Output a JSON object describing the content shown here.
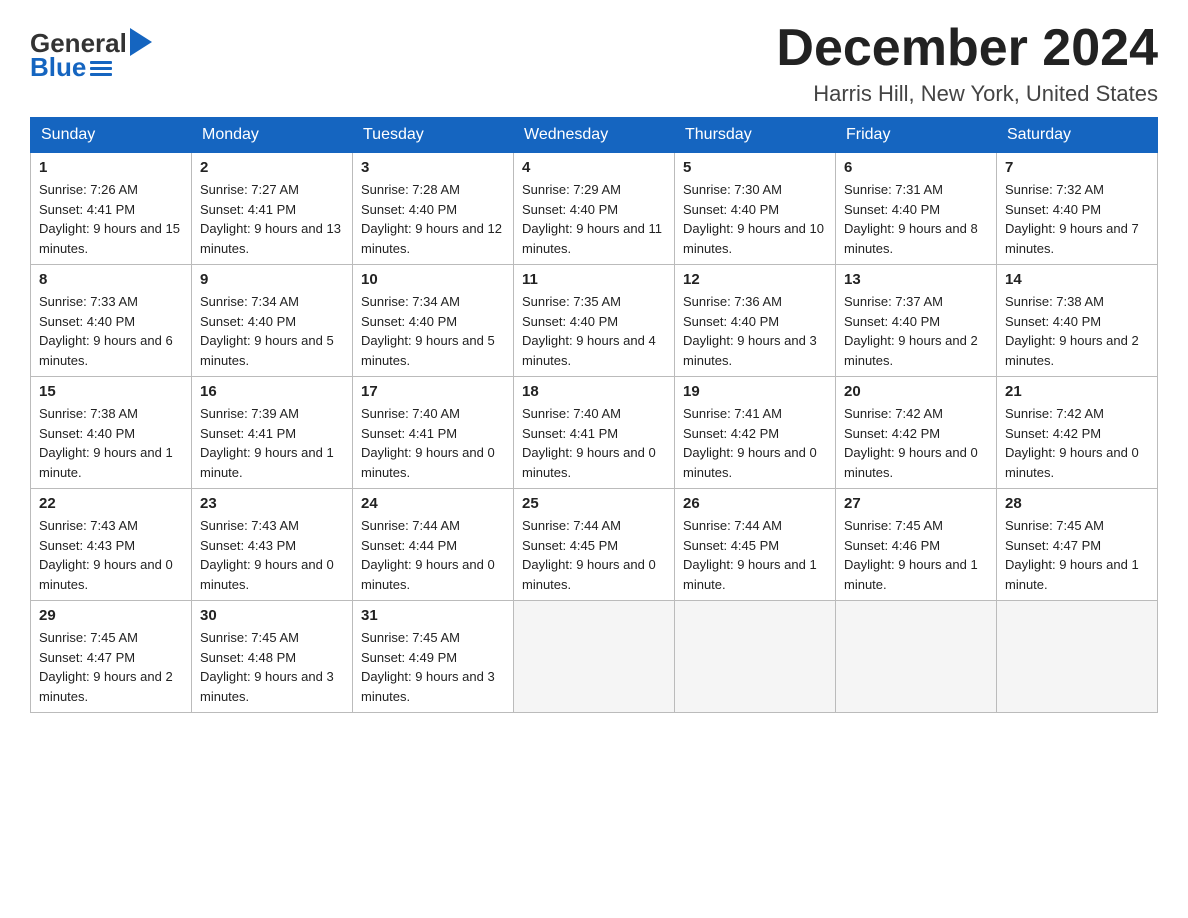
{
  "header": {
    "logo_general": "General",
    "logo_blue": "Blue",
    "month_title": "December 2024",
    "location": "Harris Hill, New York, United States"
  },
  "days_of_week": [
    "Sunday",
    "Monday",
    "Tuesday",
    "Wednesday",
    "Thursday",
    "Friday",
    "Saturday"
  ],
  "weeks": [
    [
      {
        "day": "1",
        "sunrise": "7:26 AM",
        "sunset": "4:41 PM",
        "daylight": "9 hours and 15 minutes."
      },
      {
        "day": "2",
        "sunrise": "7:27 AM",
        "sunset": "4:41 PM",
        "daylight": "9 hours and 13 minutes."
      },
      {
        "day": "3",
        "sunrise": "7:28 AM",
        "sunset": "4:40 PM",
        "daylight": "9 hours and 12 minutes."
      },
      {
        "day": "4",
        "sunrise": "7:29 AM",
        "sunset": "4:40 PM",
        "daylight": "9 hours and 11 minutes."
      },
      {
        "day": "5",
        "sunrise": "7:30 AM",
        "sunset": "4:40 PM",
        "daylight": "9 hours and 10 minutes."
      },
      {
        "day": "6",
        "sunrise": "7:31 AM",
        "sunset": "4:40 PM",
        "daylight": "9 hours and 8 minutes."
      },
      {
        "day": "7",
        "sunrise": "7:32 AM",
        "sunset": "4:40 PM",
        "daylight": "9 hours and 7 minutes."
      }
    ],
    [
      {
        "day": "8",
        "sunrise": "7:33 AM",
        "sunset": "4:40 PM",
        "daylight": "9 hours and 6 minutes."
      },
      {
        "day": "9",
        "sunrise": "7:34 AM",
        "sunset": "4:40 PM",
        "daylight": "9 hours and 5 minutes."
      },
      {
        "day": "10",
        "sunrise": "7:34 AM",
        "sunset": "4:40 PM",
        "daylight": "9 hours and 5 minutes."
      },
      {
        "day": "11",
        "sunrise": "7:35 AM",
        "sunset": "4:40 PM",
        "daylight": "9 hours and 4 minutes."
      },
      {
        "day": "12",
        "sunrise": "7:36 AM",
        "sunset": "4:40 PM",
        "daylight": "9 hours and 3 minutes."
      },
      {
        "day": "13",
        "sunrise": "7:37 AM",
        "sunset": "4:40 PM",
        "daylight": "9 hours and 2 minutes."
      },
      {
        "day": "14",
        "sunrise": "7:38 AM",
        "sunset": "4:40 PM",
        "daylight": "9 hours and 2 minutes."
      }
    ],
    [
      {
        "day": "15",
        "sunrise": "7:38 AM",
        "sunset": "4:40 PM",
        "daylight": "9 hours and 1 minute."
      },
      {
        "day": "16",
        "sunrise": "7:39 AM",
        "sunset": "4:41 PM",
        "daylight": "9 hours and 1 minute."
      },
      {
        "day": "17",
        "sunrise": "7:40 AM",
        "sunset": "4:41 PM",
        "daylight": "9 hours and 0 minutes."
      },
      {
        "day": "18",
        "sunrise": "7:40 AM",
        "sunset": "4:41 PM",
        "daylight": "9 hours and 0 minutes."
      },
      {
        "day": "19",
        "sunrise": "7:41 AM",
        "sunset": "4:42 PM",
        "daylight": "9 hours and 0 minutes."
      },
      {
        "day": "20",
        "sunrise": "7:42 AM",
        "sunset": "4:42 PM",
        "daylight": "9 hours and 0 minutes."
      },
      {
        "day": "21",
        "sunrise": "7:42 AM",
        "sunset": "4:42 PM",
        "daylight": "9 hours and 0 minutes."
      }
    ],
    [
      {
        "day": "22",
        "sunrise": "7:43 AM",
        "sunset": "4:43 PM",
        "daylight": "9 hours and 0 minutes."
      },
      {
        "day": "23",
        "sunrise": "7:43 AM",
        "sunset": "4:43 PM",
        "daylight": "9 hours and 0 minutes."
      },
      {
        "day": "24",
        "sunrise": "7:44 AM",
        "sunset": "4:44 PM",
        "daylight": "9 hours and 0 minutes."
      },
      {
        "day": "25",
        "sunrise": "7:44 AM",
        "sunset": "4:45 PM",
        "daylight": "9 hours and 0 minutes."
      },
      {
        "day": "26",
        "sunrise": "7:44 AM",
        "sunset": "4:45 PM",
        "daylight": "9 hours and 1 minute."
      },
      {
        "day": "27",
        "sunrise": "7:45 AM",
        "sunset": "4:46 PM",
        "daylight": "9 hours and 1 minute."
      },
      {
        "day": "28",
        "sunrise": "7:45 AM",
        "sunset": "4:47 PM",
        "daylight": "9 hours and 1 minute."
      }
    ],
    [
      {
        "day": "29",
        "sunrise": "7:45 AM",
        "sunset": "4:47 PM",
        "daylight": "9 hours and 2 minutes."
      },
      {
        "day": "30",
        "sunrise": "7:45 AM",
        "sunset": "4:48 PM",
        "daylight": "9 hours and 3 minutes."
      },
      {
        "day": "31",
        "sunrise": "7:45 AM",
        "sunset": "4:49 PM",
        "daylight": "9 hours and 3 minutes."
      },
      null,
      null,
      null,
      null
    ]
  ]
}
